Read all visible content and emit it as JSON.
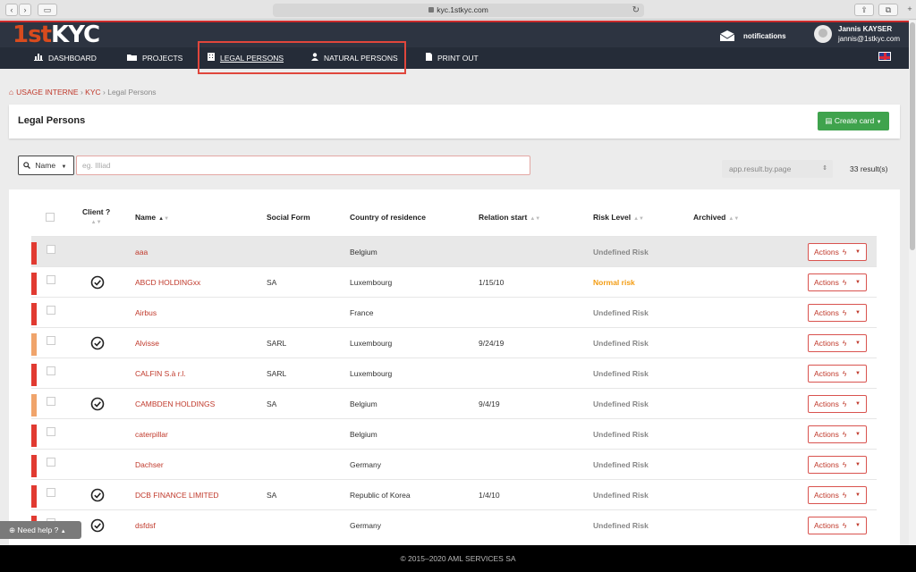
{
  "browser": {
    "url": "kyc.1stkyc.com",
    "back_icon": "chevron-left-icon",
    "forward_icon": "chevron-right-icon",
    "tabs_icon": "sidebar-icon",
    "share_icon": "share-icon",
    "reload_icon": "reload-icon"
  },
  "header": {
    "logo_num": "1st",
    "logo_name": "KYC",
    "notifications": "notifications",
    "user_name": "Jannis KAYSER",
    "user_email": "jannis@1stkyc.com"
  },
  "nav": [
    {
      "label": "DASHBOARD",
      "icon": "bar-chart-icon",
      "active": false
    },
    {
      "label": "PROJECTS",
      "icon": "folder-icon",
      "active": false
    },
    {
      "label": "LEGAL PERSONS",
      "icon": "building-icon",
      "active": true
    },
    {
      "label": "NATURAL PERSONS",
      "icon": "user-icon",
      "active": false
    },
    {
      "label": "PRINT OUT",
      "icon": "file-icon",
      "active": false
    }
  ],
  "breadcrumb": [
    "USAGE INTERNE",
    "KYC",
    "Legal Persons"
  ],
  "page": {
    "title": "Legal Persons",
    "create_label": "Create card"
  },
  "filter": {
    "field": "Name",
    "placeholder": "eg. Illiad",
    "per_page": "app.result.by.page",
    "results": "33 result(s)"
  },
  "table": {
    "headers": {
      "client": "Client ?",
      "name": "Name",
      "social_form": "Social Form",
      "country": "Country of residence",
      "relation_start": "Relation start",
      "risk_level": "Risk Level",
      "archived": "Archived"
    },
    "actions_label": "Actions",
    "rows": [
      {
        "name": "aaa",
        "client": false,
        "social_form": "",
        "country": "Belgium",
        "relation_start": "",
        "risk": "Undefined Risk",
        "bar": "#e13a31"
      },
      {
        "name": "ABCD HOLDINGxx",
        "client": true,
        "social_form": "SA",
        "country": "Luxembourg",
        "relation_start": "1/15/10",
        "risk": "Normal risk",
        "bar": "#e13a31"
      },
      {
        "name": "Airbus",
        "client": false,
        "social_form": "",
        "country": "France",
        "relation_start": "",
        "risk": "Undefined Risk",
        "bar": "#e13a31"
      },
      {
        "name": "Alvisse",
        "client": true,
        "social_form": "SARL",
        "country": "Luxembourg",
        "relation_start": "9/24/19",
        "risk": "Undefined Risk",
        "bar": "#f0a46b"
      },
      {
        "name": "CALFIN S.à r.l.",
        "client": false,
        "social_form": "SARL",
        "country": "Luxembourg",
        "relation_start": "",
        "risk": "Undefined Risk",
        "bar": "#e13a31"
      },
      {
        "name": "CAMBDEN HOLDINGS",
        "client": true,
        "social_form": "SA",
        "country": "Belgium",
        "relation_start": "9/4/19",
        "risk": "Undefined Risk",
        "bar": "#f0a46b"
      },
      {
        "name": "caterpillar",
        "client": false,
        "social_form": "",
        "country": "Belgium",
        "relation_start": "",
        "risk": "Undefined Risk",
        "bar": "#e13a31"
      },
      {
        "name": "Dachser",
        "client": false,
        "social_form": "",
        "country": "Germany",
        "relation_start": "",
        "risk": "Undefined Risk",
        "bar": "#e13a31"
      },
      {
        "name": "DCB FINANCE LIMITED",
        "client": true,
        "social_form": "SA",
        "country": "Republic of Korea",
        "relation_start": "1/4/10",
        "risk": "Undefined Risk",
        "bar": "#e13a31"
      },
      {
        "name": "dsfdsf",
        "client": true,
        "social_form": "",
        "country": "Germany",
        "relation_start": "",
        "risk": "Undefined Risk",
        "bar": "#e13a31"
      }
    ]
  },
  "help": {
    "label": "Need help ?"
  },
  "footer": {
    "text": "© 2015–2020 AML SERVICES SA"
  },
  "colors": {
    "accent_red": "#c0392b",
    "header_bg": "#2d3441",
    "create_green": "#3fa34d",
    "normal_risk": "#f39c12"
  }
}
